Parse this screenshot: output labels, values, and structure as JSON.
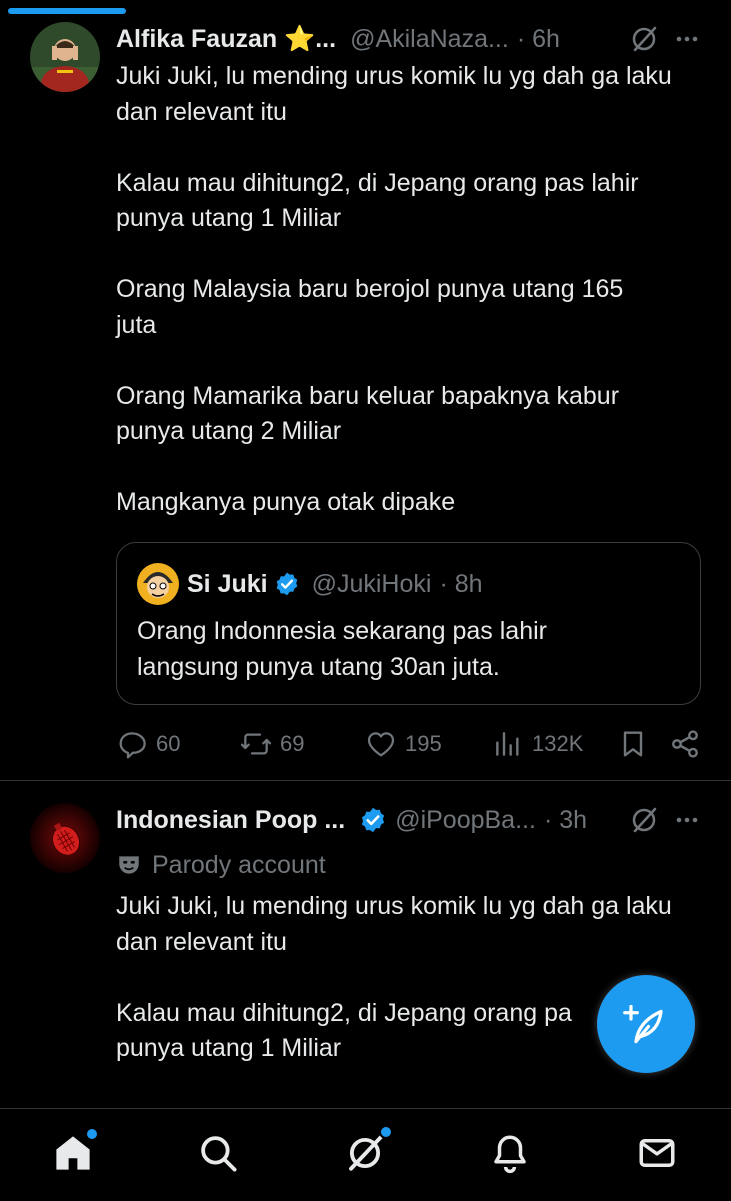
{
  "tweets": [
    {
      "display_name": "Alfika Fauzan ⭐...",
      "handle": "@AkilaNaza...",
      "time": "· 6h",
      "text": "Juki Juki, lu mending urus komik lu yg dah ga laku\ndan relevant itu\n\nKalau mau dihitung2, di Jepang orang pas lahir\npunya utang 1 Miliar\n\nOrang Malaysia baru berojol punya utang 165\njuta\n\nOrang Mamarika baru keluar bapaknya kabur\npunya utang 2 Miliar\n\nMangkanya punya otak dipake",
      "quote": {
        "display_name": "Si Juki",
        "verified": true,
        "handle": "@JukiHoki",
        "time": "· 8h",
        "text": "Orang Indonnesia sekarang pas lahir\nlangsung punya utang 30an juta."
      },
      "actions": {
        "replies": "60",
        "reposts": "69",
        "likes": "195",
        "views": "132K"
      }
    },
    {
      "display_name": "Indonesian Poop ...",
      "verified": true,
      "handle": "@iPoopBa...",
      "time": "· 3h",
      "label": "Parody account",
      "text": "Juki Juki, lu mending urus komik lu yg dah ga laku\ndan relevant itu\n\nKalau mau dihitung2, di Jepang orang pa\npunya utang 1 Miliar"
    }
  ],
  "nav": [
    "home-icon",
    "search-icon",
    "grok-icon",
    "notifications-icon",
    "messages-icon"
  ],
  "colors": {
    "accent": "#1d9bf0",
    "background": "#000000",
    "muted": "#71767b"
  }
}
